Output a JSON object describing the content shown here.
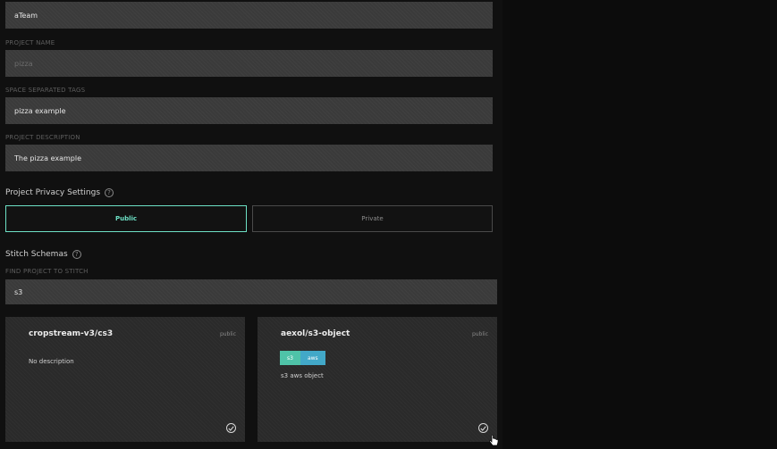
{
  "form": {
    "team_value": "aTeam",
    "project_name_label": "PROJECT NAME",
    "project_name_value": "pizza",
    "tags_label": "SPACE SEPARATED TAGS",
    "tags_value": "pizza example",
    "description_label": "PROJECT DESCRIPTION",
    "description_value": "The pizza example"
  },
  "privacy": {
    "title": "Project Privacy Settings",
    "public_label": "Public",
    "private_label": "Private",
    "selected": "Public",
    "accent_color": "#6de1c6"
  },
  "stitch": {
    "title": "Stitch Schemas",
    "search_label": "FIND PROJECT TO STITCH",
    "search_value": "s3"
  },
  "cards": [
    {
      "title": "cropstream-v3/cs3",
      "visibility": "public",
      "description": "No description",
      "tags": []
    },
    {
      "title": "aexol/s3-object",
      "visibility": "public",
      "description": "s3 aws object",
      "tags": [
        {
          "label": "s3",
          "color": "#4fc3a8"
        },
        {
          "label": "aws",
          "color": "#42a8c8"
        }
      ]
    }
  ]
}
